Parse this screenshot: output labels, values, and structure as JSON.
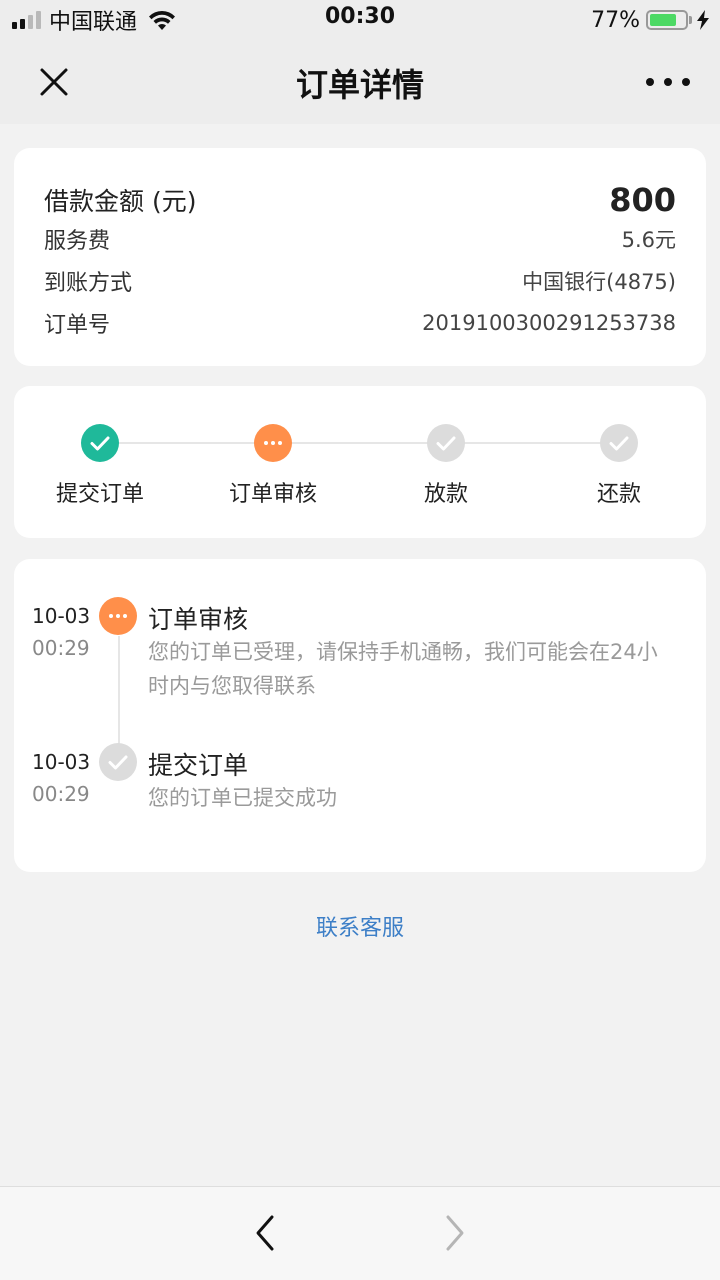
{
  "status_bar": {
    "carrier": "中国联通",
    "time": "00:30",
    "battery": "77%",
    "battery_level": 0.77
  },
  "nav": {
    "title": "订单详情"
  },
  "info": {
    "amount_label": "借款金额 (元)",
    "amount_value": "800",
    "fee_label": "服务费",
    "fee_value": "5.6元",
    "method_label": "到账方式",
    "method_value": "中国银行(4875)",
    "order_label": "订单号",
    "order_value": "201910030029125373​8"
  },
  "progress": {
    "steps": [
      {
        "label": "提交订单",
        "state": "done"
      },
      {
        "label": "订单审核",
        "state": "active"
      },
      {
        "label": "放款",
        "state": "pending"
      },
      {
        "label": "还款",
        "state": "pending"
      }
    ]
  },
  "timeline": [
    {
      "date": "10-03",
      "time": "00:29",
      "title": "订单审核",
      "desc": "您的订单已受理，请保持手机通畅，我们可能会在24小时内与您取得联系",
      "state": "active"
    },
    {
      "date": "10-03",
      "time": "00:29",
      "title": "提交订单",
      "desc": "您的订单已提交成功",
      "state": "pending"
    }
  ],
  "contact_label": "联系客服",
  "colors": {
    "done": "#1fb99a",
    "active": "#ff8f4a",
    "pending": "#dcdcdc",
    "link": "#3d7fc7"
  }
}
